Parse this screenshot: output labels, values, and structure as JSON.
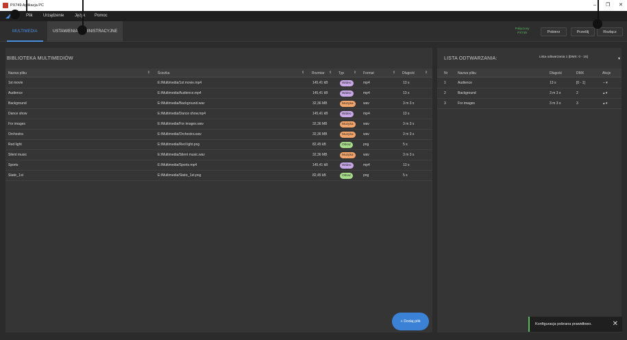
{
  "window": {
    "title": "PX749 Aplikacja PC",
    "controls": [
      "–",
      "❐",
      "✕"
    ]
  },
  "menu": {
    "items": [
      "Plik",
      "Urządzenie",
      "Język",
      "Pomoc"
    ]
  },
  "tabs": [
    {
      "label": "MULTIMEDIA",
      "active": true
    },
    {
      "label": "USTAWIENIA ADMINISTRACYJNE",
      "active": false
    }
  ],
  "device_status": {
    "line1": "Połączony",
    "line2": "PX749"
  },
  "top_buttons": {
    "download": "Pobierz",
    "send": "Prześlij",
    "disconnect": "Rozłącz"
  },
  "library": {
    "title": "BIBLIOTEKA MULTIMEDIÓW",
    "columns": [
      "Nazwa pliku",
      "Ścieżka",
      "Rozmiar",
      "Typ",
      "Format",
      "Długość"
    ],
    "rows": [
      {
        "name": "1st movie",
        "path": "E:/Multimedia/1st movie.mp4",
        "size": "145,41 kB",
        "type": "Wideo",
        "format": "mp4",
        "length": "13 s"
      },
      {
        "name": "Audience",
        "path": "E:/Multimedia/Audience.mp4",
        "size": "145,41 kB",
        "type": "Wideo",
        "format": "mp4",
        "length": "13 s"
      },
      {
        "name": "Background",
        "path": "E:/Multimedia/Background.wav",
        "size": "32,36 MB",
        "type": "Muzyka",
        "format": "wav",
        "length": "3 m 3 s"
      },
      {
        "name": "Dance show",
        "path": "E:/Multimedia/Dance show.mp4",
        "size": "145,41 kB",
        "type": "Wideo",
        "format": "mp4",
        "length": "13 s"
      },
      {
        "name": "For images",
        "path": "E:/Multimedia/For images.wav",
        "size": "32,36 MB",
        "type": "Muzyka",
        "format": "wav",
        "length": "3 m 3 s"
      },
      {
        "name": "Orchestra",
        "path": "E:/Multimedia/Orchestra.wav",
        "size": "32,36 MB",
        "type": "Muzyka",
        "format": "wav",
        "length": "3 m 3 s"
      },
      {
        "name": "Red light",
        "path": "E:/Multimedia/Red light.png",
        "size": "82,45 kB",
        "type": "Obraz",
        "format": "png",
        "length": "5 s"
      },
      {
        "name": "Silent music",
        "path": "E:/Multimedia/Silent music.wav",
        "size": "32,36 MB",
        "type": "Muzyka",
        "format": "wav",
        "length": "3 m 3 s"
      },
      {
        "name": "Sports",
        "path": "E:/Multimedia/Sports.mp4",
        "size": "145,41 kB",
        "type": "Wideo",
        "format": "mp4",
        "length": "13 s"
      },
      {
        "name": "Static_1st",
        "path": "E:/Multimedia/Static_1st.png",
        "size": "82,45 kB",
        "type": "Obraz",
        "format": "png",
        "length": "5 s"
      }
    ],
    "add_button": "+ Dodaj plik"
  },
  "playlist": {
    "title": "LISTA ODTWARZANIA:",
    "selector": "Lista odtwarzania 1 [DMX: 0 - 15]",
    "columns": [
      "Nr",
      "Nazwa pliku",
      "Długość",
      "DMX",
      "Akcje"
    ],
    "rows": [
      {
        "nr": "1",
        "name": "Audience",
        "length": "13 s",
        "dmx": "[0 - 1]",
        "actions": "–  ▾"
      },
      {
        "nr": "2",
        "name": "Background",
        "length": "3 m 3 s",
        "dmx": "2",
        "actions": "▴  ▾"
      },
      {
        "nr": "3",
        "name": "For images",
        "length": "3 m 3 s",
        "dmx": "3",
        "actions": "▴  ▾"
      }
    ]
  },
  "toast": {
    "message": "Konfiguracja pobrana prawidłowo.",
    "close": "✕"
  },
  "colors": {
    "accent": "#4a90e2",
    "connected": "#5cb85c",
    "wideo": "#c9a8e8",
    "muzyka": "#f2a56b",
    "obraz": "#a7dd8a"
  }
}
